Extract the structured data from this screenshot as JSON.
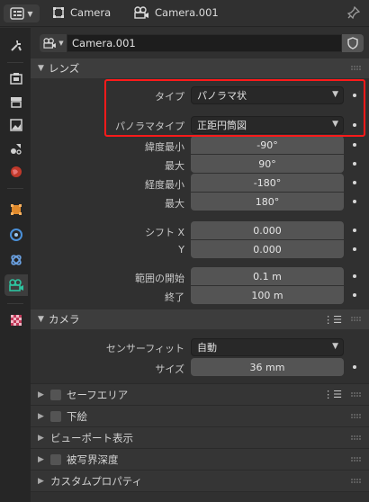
{
  "header": {
    "object_name": "Camera",
    "data_name": "Camera.001"
  },
  "tabs": [
    {
      "name": "tool-tab-icon"
    },
    {
      "name": "render-tab-icon"
    },
    {
      "name": "output-tab-icon"
    },
    {
      "name": "view-layer-tab-icon"
    },
    {
      "name": "scene-tab-icon"
    },
    {
      "name": "world-tab-icon"
    },
    {
      "name": "object-tab-icon"
    },
    {
      "name": "modifier-tab-icon"
    },
    {
      "name": "physics-tab-icon"
    },
    {
      "name": "camera-data-tab-icon"
    },
    {
      "name": "texture-tab-icon"
    }
  ],
  "datablock": {
    "name": "Camera.001"
  },
  "lens_panel": {
    "title": "レンズ",
    "type_label": "タイプ",
    "type_value": "パノラマ状",
    "pano_type_label": "パノラマタイプ",
    "pano_type_value": "正距円筒図",
    "lat_min_label": "緯度最小",
    "lat_min_value": "-90°",
    "lat_max_label": "最大",
    "lat_max_value": "90°",
    "lon_min_label": "経度最小",
    "lon_min_value": "-180°",
    "lon_max_label": "最大",
    "lon_max_value": "180°",
    "shift_x_label": "シフト X",
    "shift_x_value": "0.000",
    "shift_y_label": "Y",
    "shift_y_value": "0.000",
    "clip_start_label": "範囲の開始",
    "clip_start_value": "0.1 m",
    "clip_end_label": "終了",
    "clip_end_value": "100 m"
  },
  "camera_panel": {
    "title": "カメラ",
    "sensor_fit_label": "センサーフィット",
    "sensor_fit_value": "自動",
    "size_label": "サイズ",
    "size_value": "36 mm"
  },
  "collapsed_panels": [
    {
      "label": "セーフエリア"
    },
    {
      "label": "下絵"
    },
    {
      "label": "ビューポート表示"
    },
    {
      "label": "被写界深度"
    },
    {
      "label": "カスタムプロパティ"
    }
  ],
  "colors": {
    "highlight": "#ff1a1a",
    "field": "#545454",
    "background": "#303030"
  }
}
